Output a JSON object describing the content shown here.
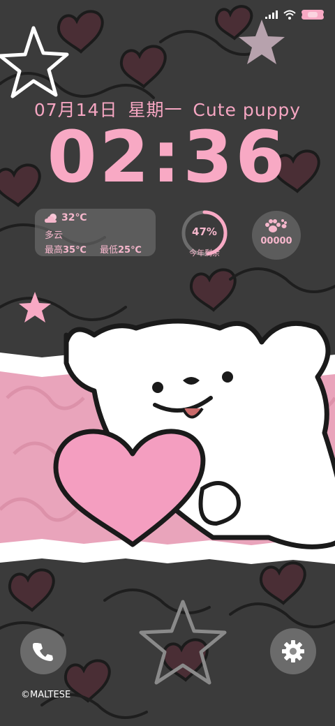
{
  "status_bar": {
    "icons": [
      "signal-icon",
      "wifi-icon",
      "battery-icon"
    ]
  },
  "lockscreen": {
    "date": "07月14日",
    "weekday": "星期一",
    "slogan": "Cute puppy",
    "time": "02:36"
  },
  "weather": {
    "icon": "partly-cloudy-icon",
    "temp": "32℃",
    "condition": "多云",
    "high_label": "最高",
    "high_value": "35℃",
    "low_label": "最低",
    "low_value": "25℃"
  },
  "year_progress": {
    "percent_text": "47%",
    "fraction": 0.47,
    "label": "今年剩余"
  },
  "steps": {
    "icon": "paw-icon",
    "count": "00000"
  },
  "shortcuts": {
    "left": "phone-icon",
    "right": "settings-icon"
  },
  "footer": {
    "copyright": "©MALTESE"
  },
  "colors": {
    "accent_pink": "#f8a9c4",
    "background": "#3a3a3a",
    "band_pink": "#e9a4bb"
  }
}
